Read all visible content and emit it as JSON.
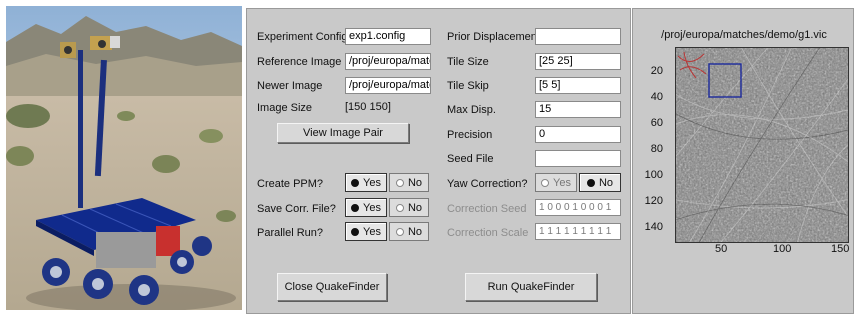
{
  "form": {
    "experiment_config": {
      "label": "Experiment Config",
      "value": "exp1.config"
    },
    "reference_image": {
      "label": "Reference Image",
      "value": "/proj/europa/matct"
    },
    "newer_image": {
      "label": "Newer Image",
      "value": "/proj/europa/matct"
    },
    "image_size": {
      "label": "Image Size",
      "value": "[150 150]"
    },
    "view_pair_button": "View Image Pair",
    "create_ppm": {
      "label": "Create PPM?",
      "yes": "Yes",
      "no": "No",
      "selected": "Yes"
    },
    "save_corr": {
      "label": "Save Corr. File?",
      "yes": "Yes",
      "no": "No",
      "selected": "Yes"
    },
    "parallel_run": {
      "label": "Parallel Run?",
      "yes": "Yes",
      "no": "No",
      "selected": "Yes"
    },
    "prior_displacement": {
      "label": "Prior Displacement",
      "value": ""
    },
    "tile_size": {
      "label": "Tile Size",
      "value": "[25  25]"
    },
    "tile_skip": {
      "label": "Tile Skip",
      "value": "[5  5]"
    },
    "max_disp": {
      "label": "Max Disp.",
      "value": "15"
    },
    "precision": {
      "label": "Precision",
      "value": "0"
    },
    "seed_file": {
      "label": "Seed File",
      "value": ""
    },
    "yaw_correction": {
      "label": "Yaw Correction?",
      "yes": "Yes",
      "no": "No",
      "selected": "No"
    },
    "correction_seed": {
      "label": "Correction Seed",
      "value": "1 0 0 0 1 0 0 0 1"
    },
    "correction_scale": {
      "label": "Correction Scale",
      "value": "1 1 1 1 1 1 1 1 1"
    },
    "close_button": "Close QuakeFinder",
    "run_button": "Run QuakeFinder"
  },
  "viewer": {
    "title": "/proj/europa/matches/demo/g1.vic",
    "y_ticks": [
      "20",
      "40",
      "60",
      "80",
      "100",
      "120",
      "140"
    ],
    "x_ticks": [
      "50",
      "100",
      "150"
    ]
  },
  "colors": {
    "panel": "#c9c9c9",
    "selection_box": "#1c2a9c",
    "feature_highlight": "#c21f1f"
  }
}
